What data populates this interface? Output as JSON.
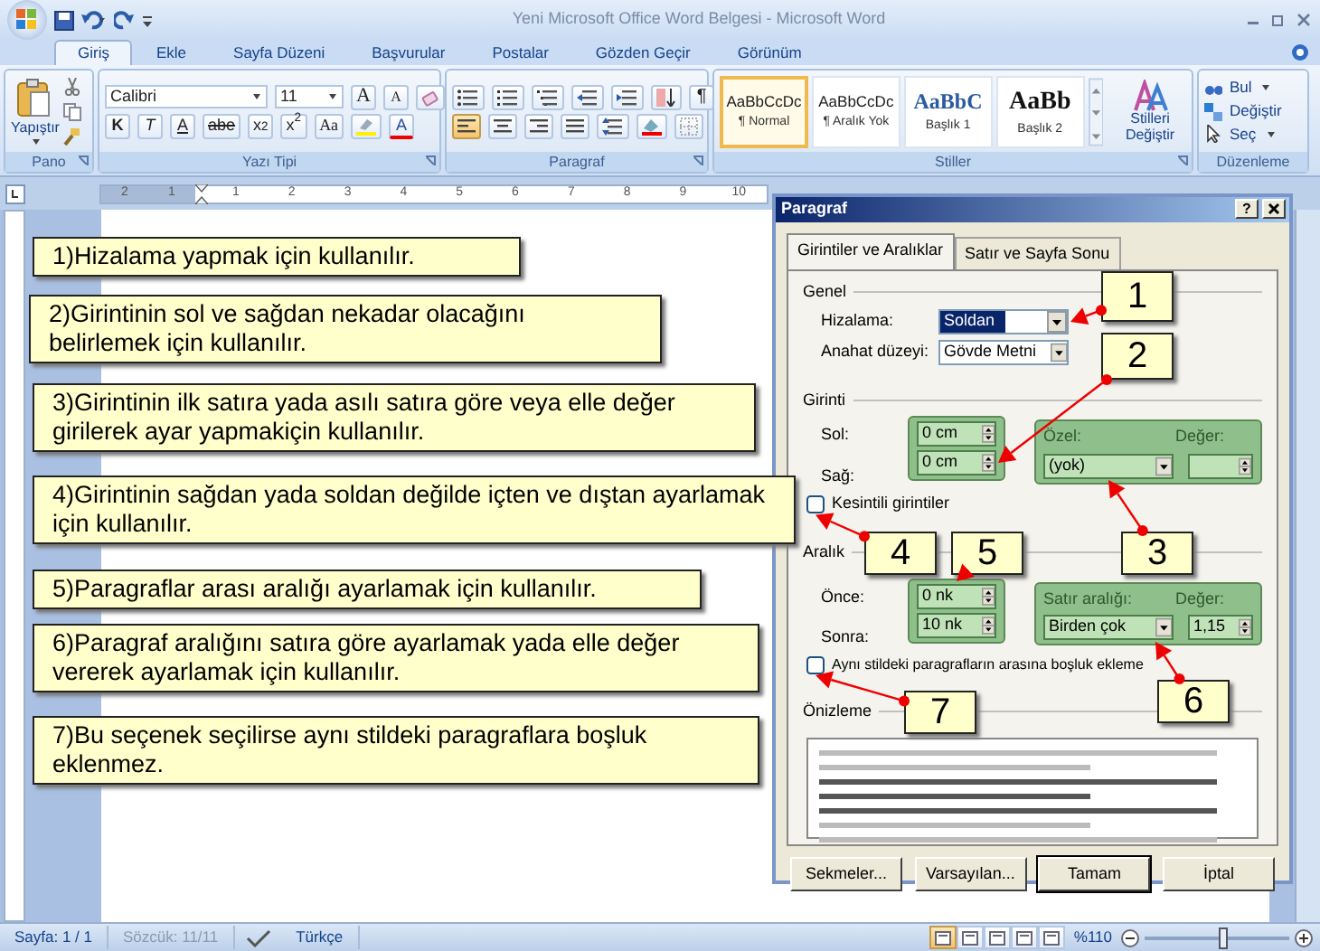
{
  "window": {
    "title": "Yeni Microsoft Office Word Belgesi - Microsoft Word"
  },
  "tabs": [
    {
      "label": "Giriş",
      "selected": true
    },
    {
      "label": "Ekle",
      "selected": false
    },
    {
      "label": "Sayfa Düzeni",
      "selected": false
    },
    {
      "label": "Başvurular",
      "selected": false
    },
    {
      "label": "Postalar",
      "selected": false
    },
    {
      "label": "Gözden Geçir",
      "selected": false
    },
    {
      "label": "Görünüm",
      "selected": false
    }
  ],
  "ribbon": {
    "clipboard": {
      "paste_label": "Yapıştır",
      "group_label": "Pano"
    },
    "font": {
      "name": "Calibri",
      "size": "11",
      "size_buttons": [
        "A",
        "A"
      ],
      "format_buttons": [
        "K",
        "T",
        "A",
        "abe",
        "x$_{2}$",
        "x$^{2}$",
        "Aa"
      ],
      "color_button": "A",
      "group_label": "Yazı Tipi"
    },
    "paragraph": {
      "pilcrow": "¶",
      "align_buttons": [
        {
          "selected": true
        },
        {
          "selected": false
        },
        {
          "selected": false
        },
        {
          "selected": false
        }
      ],
      "group_label": "Paragraf"
    },
    "styles": {
      "items": [
        {
          "preview": "AaBbCcDc",
          "name": "¶ Normal",
          "kind": "body",
          "selected": true
        },
        {
          "preview": "AaBbCcDc",
          "name": "¶ Aralık Yok",
          "kind": "body",
          "selected": false
        },
        {
          "preview": "AaBbC",
          "name": "Başlık 1",
          "kind": "heading1",
          "selected": false
        },
        {
          "preview": "AaBb",
          "name": "Başlık 2",
          "kind": "heading2",
          "selected": false
        }
      ],
      "change_label": "Stilleri Değiştir",
      "group_label": "Stiller"
    },
    "editing": {
      "items": [
        {
          "label": "Bul",
          "dropdown": true
        },
        {
          "label": "Değiştir",
          "dropdown": false
        },
        {
          "label": "Seç",
          "dropdown": true
        }
      ],
      "group_label": "Düzenleme"
    }
  },
  "ruler": {
    "left_labels": [
      "2",
      "1"
    ],
    "right_labels": [
      "1",
      "2",
      "3",
      "4",
      "5",
      "6",
      "7",
      "8",
      "9",
      "10"
    ]
  },
  "callouts": [
    "1)Hizalama yapmak için kullanılır.",
    "2)Girintinin sol ve sağdan nekadar olacağını belirlemek için kullanılır.",
    "3)Girintinin ilk satıra yada asılı satıra göre veya elle değer girilerek ayar yapmakiçin kullanılır.",
    "4)Girintinin sağdan yada soldan değilde içten ve dıştan ayarlamak için kullanılır.",
    "5)Paragraflar arası aralığı ayarlamak için kullanılır.",
    "6)Paragraf aralığını satıra göre ayarlamak yada elle değer vererek ayarlamak için kullanılır.",
    "7)Bu seçenek seçilirse aynı stildeki paragraflara boşluk eklenmez."
  ],
  "markers": [
    "1",
    "2",
    "4",
    "5",
    "3",
    "6",
    "7"
  ],
  "dialog": {
    "title": "Paragraf",
    "help": "?",
    "tabs": [
      {
        "label": "Girintiler ve Aralıklar",
        "selected": true
      },
      {
        "label": "Satır ve Sayfa Sonu",
        "selected": false
      }
    ],
    "general": {
      "heading": "Genel",
      "alignment": {
        "label": "Hizalama:",
        "value": "Soldan",
        "focused": true
      },
      "outline": {
        "label": "Anahat düzeyi:",
        "value": "Gövde Metni",
        "focused": false
      }
    },
    "indent": {
      "heading": "Girinti",
      "left": {
        "label": "Sol:",
        "value": "0 cm"
      },
      "right": {
        "label": "Sağ:",
        "value": "0 cm"
      },
      "special": {
        "label": "Özel:",
        "value": "(yok)"
      },
      "by": {
        "label": "Değer:"
      },
      "mirror": {
        "label": "Kesintili girintiler",
        "checked": false
      }
    },
    "spacing": {
      "heading": "Aralık",
      "before": {
        "label": "Önce:",
        "value": "0 nk"
      },
      "after": {
        "label": "Sonra:",
        "value": "10 nk"
      },
      "line": {
        "label": "Satır aralığı:",
        "value": "Birden çok"
      },
      "at": {
        "label": "Değer:",
        "value": "1,15"
      },
      "no_space": {
        "label": "Aynı stildeki paragrafların arasına boşluk ekleme",
        "checked": false
      }
    },
    "preview": {
      "heading": "Önizleme"
    },
    "buttons": [
      {
        "label": "Sekmeler...",
        "default": false
      },
      {
        "label": "Varsayılan...",
        "default": false
      },
      {
        "label": "Tamam",
        "default": true
      },
      {
        "label": "İptal",
        "default": false
      }
    ]
  },
  "status_bar": {
    "page": "Sayfa: 1 / 1",
    "words": "Sözcük: 11/11",
    "language": "Türkçe",
    "views": [
      {
        "selected": true
      },
      {
        "selected": false
      },
      {
        "selected": false
      },
      {
        "selected": false
      },
      {
        "selected": false
      }
    ],
    "zoom": "%110",
    "zoom_slider": {
      "level": 0.55
    }
  }
}
